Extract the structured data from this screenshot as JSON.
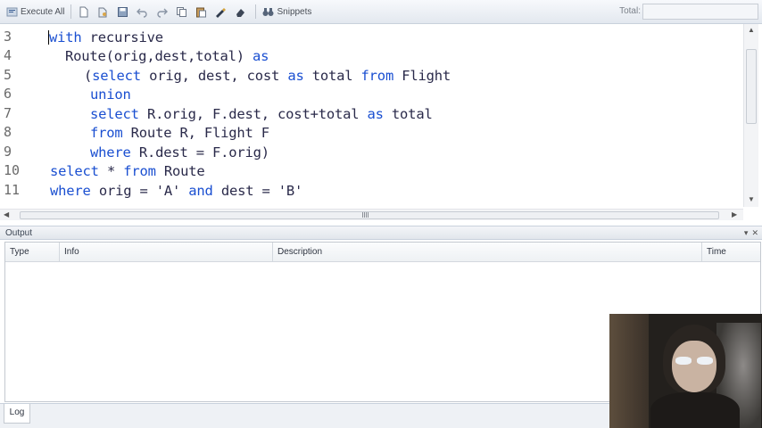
{
  "toolbar": {
    "execute_label": "Execute All",
    "snippets_label": "Snippets",
    "total_label": "Total:",
    "total_value": ""
  },
  "editor": {
    "line_numbers": [
      "3",
      "4",
      "5",
      "6",
      "7",
      "8",
      "9",
      "10",
      "11"
    ],
    "keyword_color": "#1a4fd1"
  },
  "output": {
    "title": "Output",
    "columns": [
      "Type",
      "Info",
      "Description",
      "Time"
    ]
  },
  "tabs": {
    "log": "Log"
  }
}
